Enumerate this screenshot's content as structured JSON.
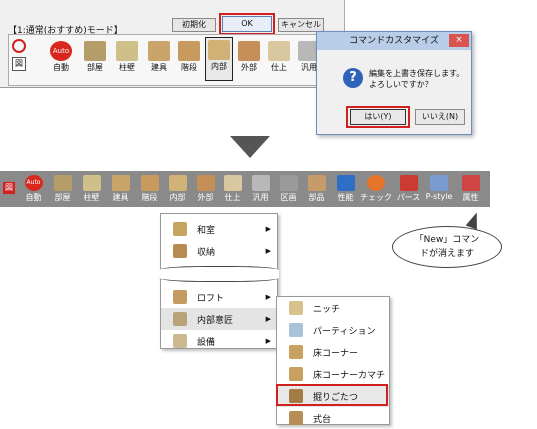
{
  "top_panel": {
    "mode_label": "【1:通常(おすすめ)モード】",
    "init_label": "初期化",
    "ok_label": "OK",
    "cancel_label": "キャンセル",
    "buttons": [
      {
        "label": "自動",
        "color": "#d8281e"
      },
      {
        "label": "部屋",
        "color": "#b59d6a"
      },
      {
        "label": "柱壁",
        "color": "#cfbf88"
      },
      {
        "label": "建具",
        "color": "#caa56a"
      },
      {
        "label": "階段",
        "color": "#c89a5d"
      },
      {
        "label": "内部",
        "color": "#d1b276"
      },
      {
        "label": "外部",
        "color": "#c58f57"
      },
      {
        "label": "仕上",
        "color": "#d9c89f"
      },
      {
        "label": "汎用",
        "color": "#b8b8b8"
      }
    ],
    "side_label": "図",
    "auto_label": "Auto"
  },
  "dialog": {
    "title": "コマンドカスタマイズ",
    "close": "×",
    "icon_glyph": "?",
    "message1": "編集を上書き保存します。",
    "message2": "よろしいですか？",
    "yes": "はい(Y)",
    "no": "いいえ(N)"
  },
  "toolbar": {
    "items": [
      {
        "label": "自動",
        "color": "#d8281e"
      },
      {
        "label": "部屋",
        "color": "#b59d6a"
      },
      {
        "label": "柱壁",
        "color": "#cfbf88"
      },
      {
        "label": "建具",
        "color": "#caa56a"
      },
      {
        "label": "階段",
        "color": "#c89a5d"
      },
      {
        "label": "内部",
        "color": "#d1b276"
      },
      {
        "label": "外部",
        "color": "#c58f57"
      },
      {
        "label": "仕上",
        "color": "#d9c89f"
      },
      {
        "label": "汎用",
        "color": "#b8b8b8"
      },
      {
        "label": "区画",
        "color": "#9a9a9a"
      },
      {
        "label": "部品",
        "color": "#c79a6a"
      },
      {
        "label": "性能",
        "color": "#2d6fc6"
      },
      {
        "label": "チェック",
        "color": "#e8732a"
      },
      {
        "label": "パース",
        "color": "#cc3a34"
      },
      {
        "label": "P-style",
        "color": "#7a9bd0"
      },
      {
        "label": "属性",
        "color": "#d04444"
      }
    ],
    "side_label": "図",
    "auto_label": "Auto"
  },
  "menu": {
    "items": [
      {
        "label": "和室",
        "color": "#c6a55e"
      },
      {
        "label": "収納",
        "color": "#b78c52"
      },
      {
        "label": "ロフト",
        "color": "#c59a63"
      },
      {
        "label": "内部意匠",
        "color": "#b9a27a"
      },
      {
        "label": "設備",
        "color": "#cbb88f"
      }
    ]
  },
  "submenu": {
    "items": [
      {
        "label": "ニッチ",
        "color": "#d6c28e"
      },
      {
        "label": "パーティション",
        "color": "#a8c2d8"
      },
      {
        "label": "床コーナー",
        "color": "#c8a060"
      },
      {
        "label": "床コーナーカマチ",
        "color": "#c8a060"
      },
      {
        "label": "掘りごたつ",
        "color": "#a27b45"
      },
      {
        "label": "式台",
        "color": "#b58d55"
      }
    ]
  },
  "callout": {
    "line1": "「New」コマン",
    "line2": "ドが消えます"
  }
}
